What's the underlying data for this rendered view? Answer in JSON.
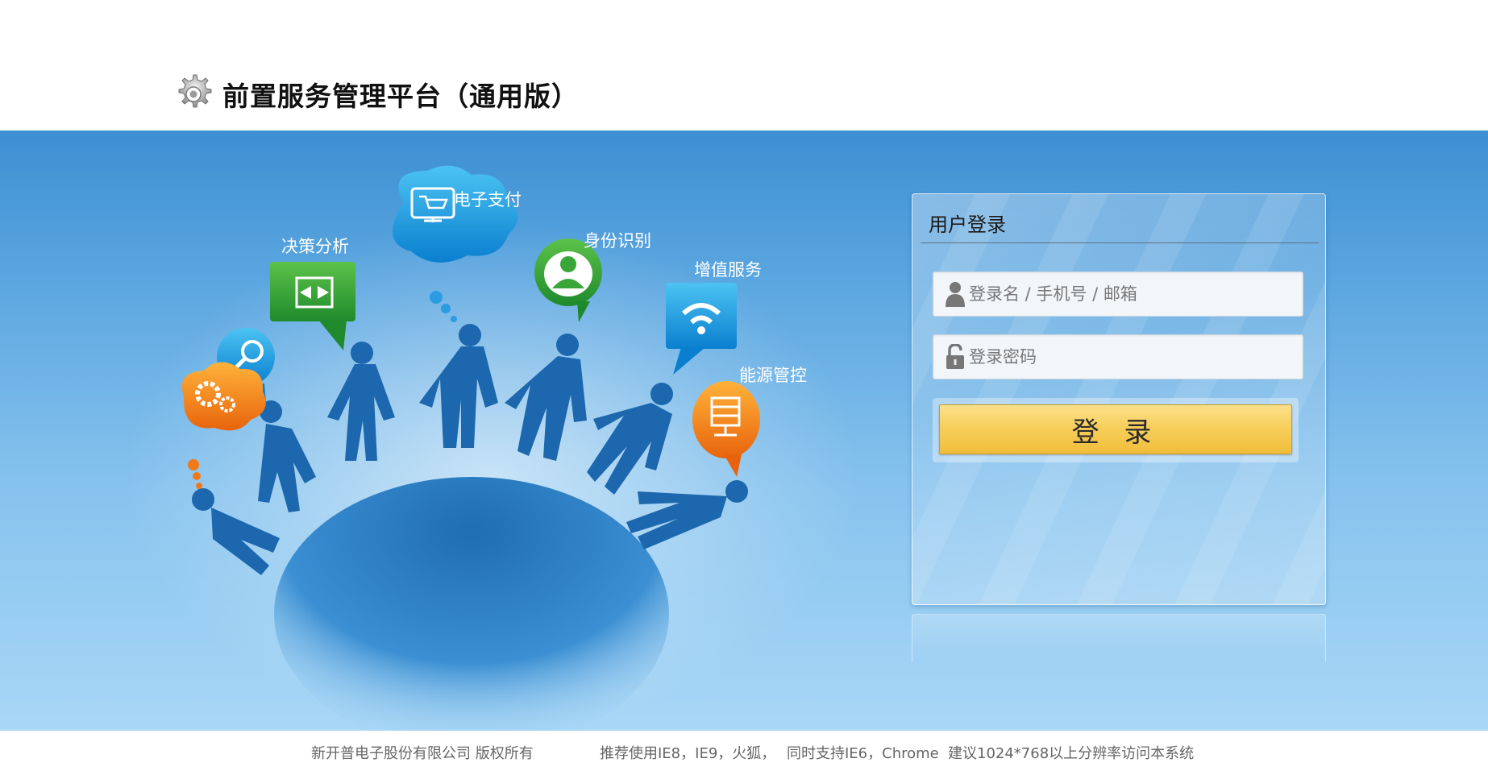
{
  "header": {
    "title": "前置服务管理平台（通用版）",
    "logo_icon": "gear-icon"
  },
  "illustration": {
    "labels": {
      "payment": "电子支付",
      "decision": "决策分析",
      "identity": "身份识别",
      "value_added": "增值服务",
      "energy": "能源管控"
    },
    "icons": [
      "cart-icon",
      "decision-chart-icon",
      "id-user-icon",
      "wifi-icon",
      "server-icon",
      "search-icon",
      "gears-icon"
    ]
  },
  "login": {
    "title": "用户登录",
    "username_placeholder": "登录名 / 手机号 / 邮箱",
    "password_placeholder": "登录密码",
    "submit_label": "登 录",
    "user_icon": "user-icon",
    "lock_icon": "lock-icon"
  },
  "footer": {
    "copyright": "新开普电子股份有限公司 版权所有",
    "browser": "推荐使用IE8，IE9，火狐，",
    "support": "同时支持IE6，Chrome",
    "resolution": "建议1024*768以上分辨率访问本系统"
  },
  "colors": {
    "banner_top": "#3d8fd2",
    "banner_bottom": "#a9d7f6",
    "button_yellow": "#f7cf5c"
  }
}
